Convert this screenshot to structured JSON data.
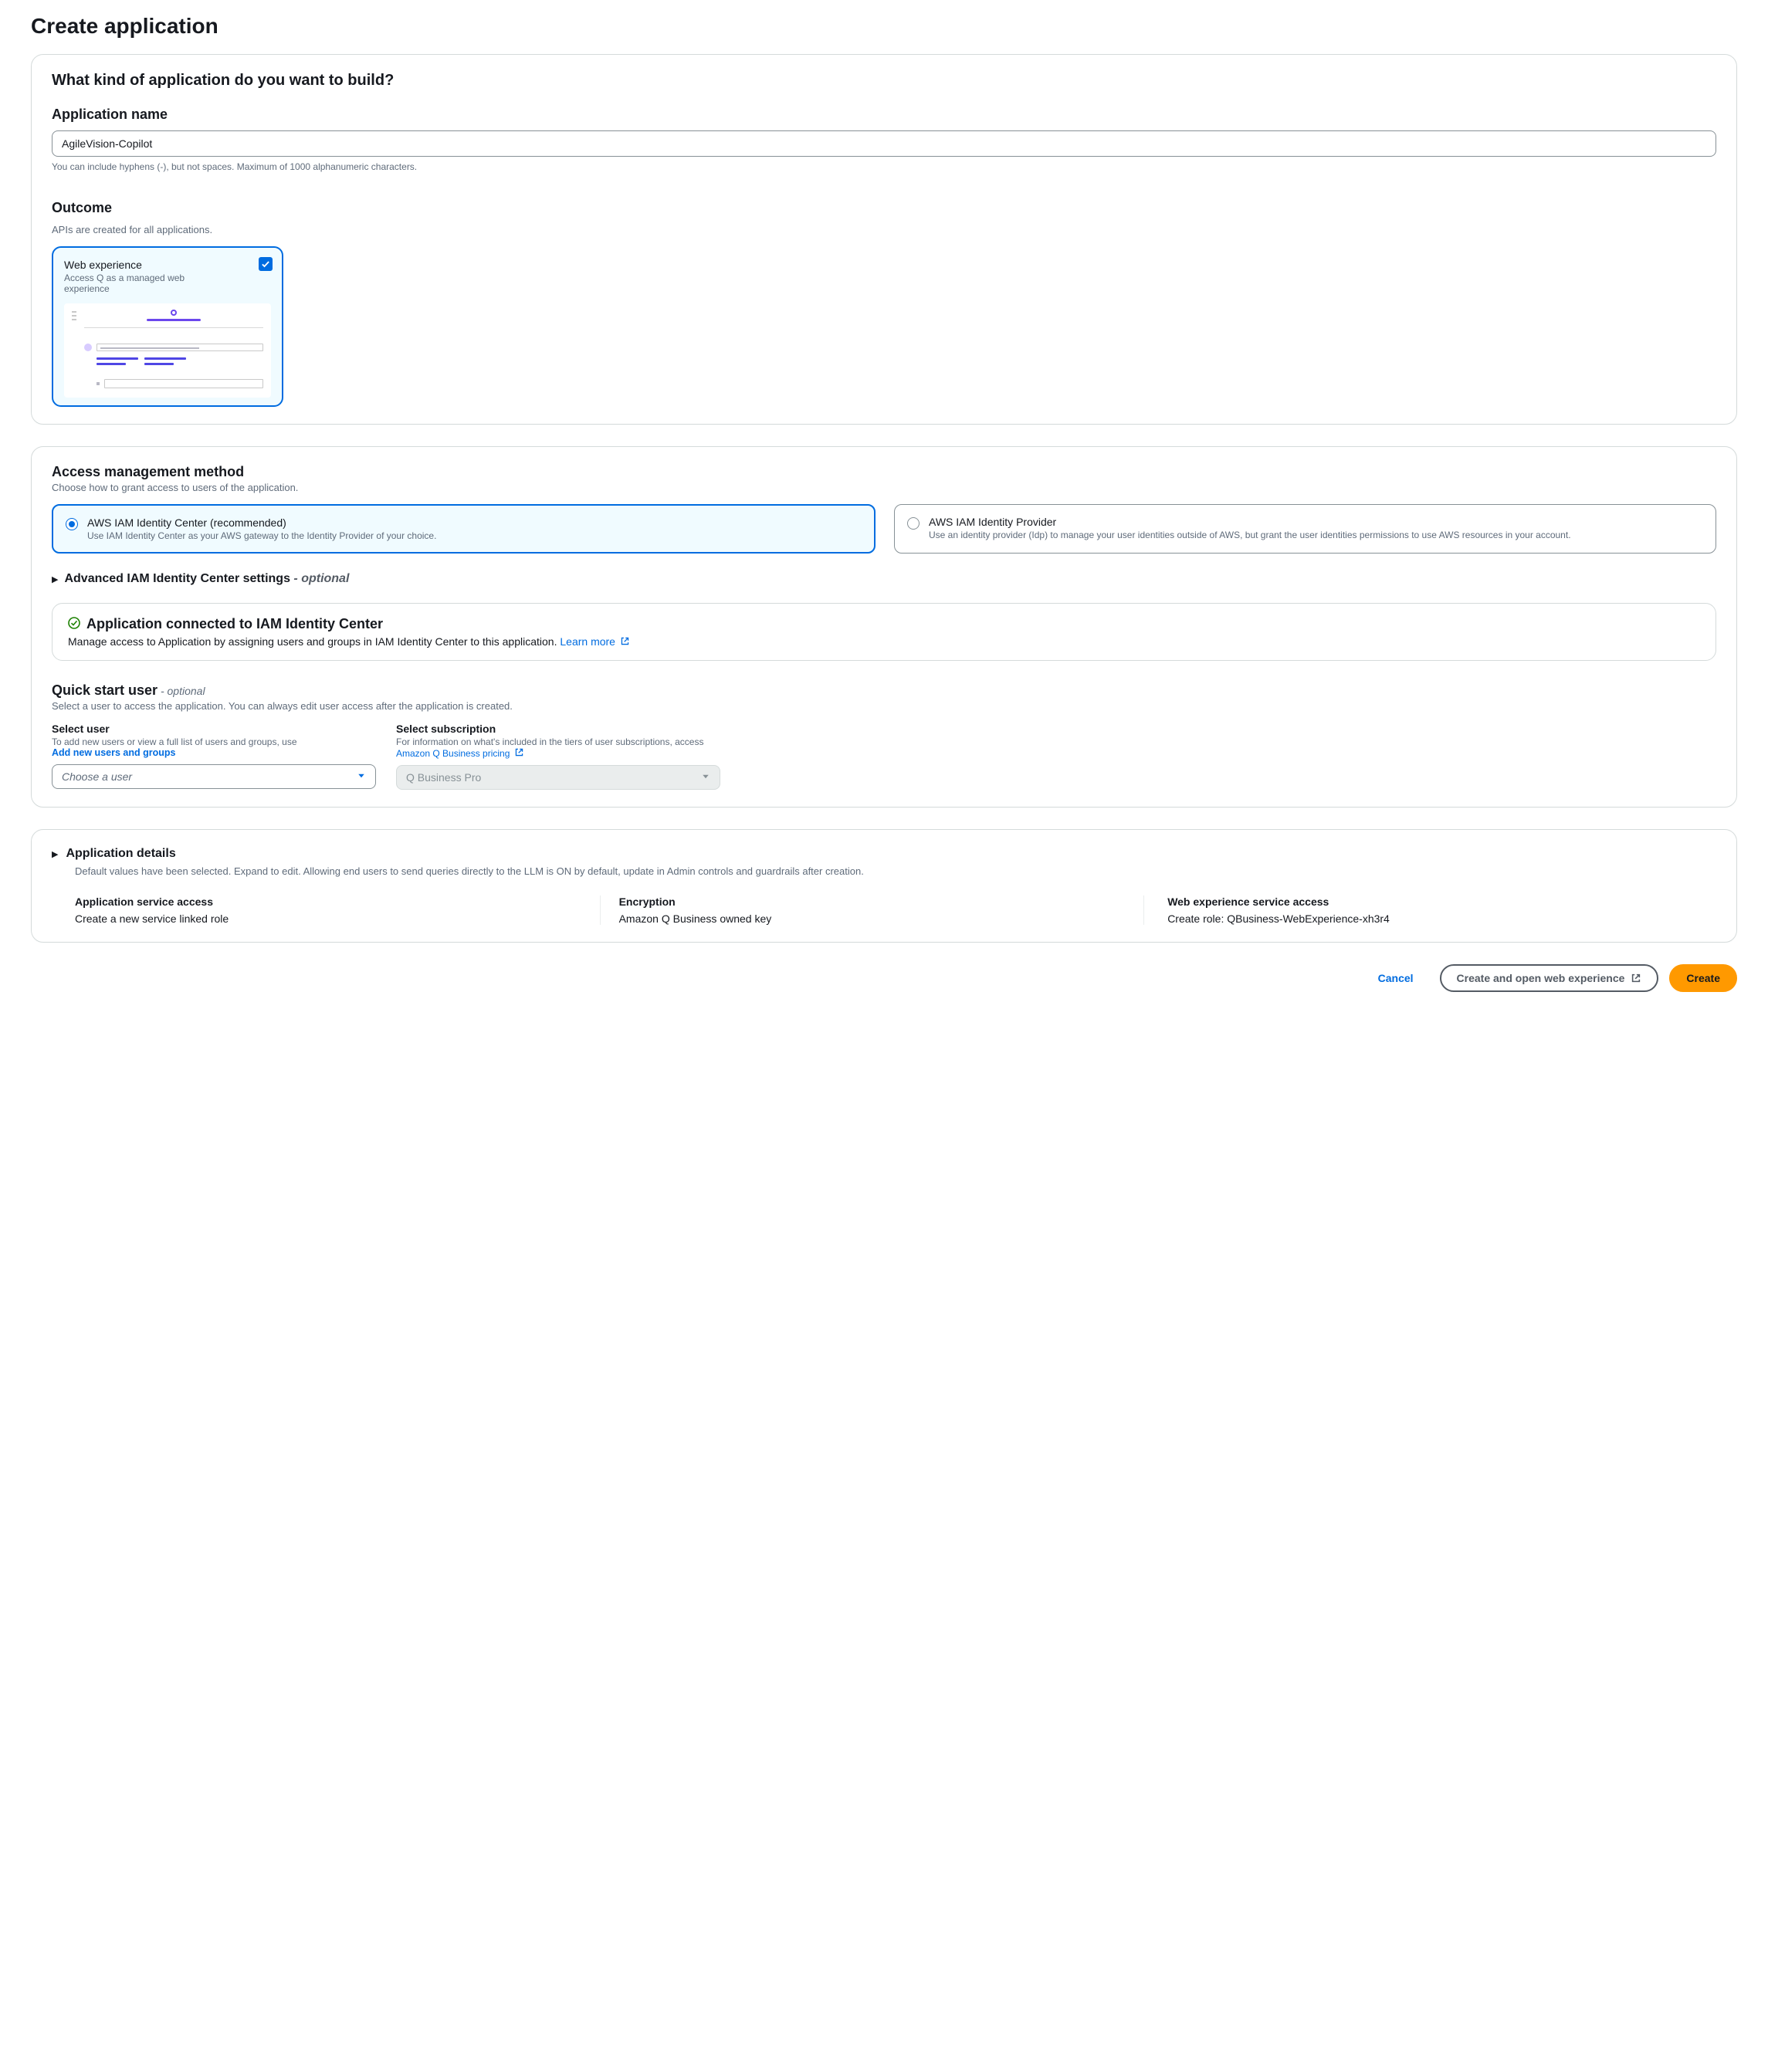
{
  "page": {
    "title": "Create application"
  },
  "kind": {
    "heading": "What kind of application do you want to build?",
    "name_label": "Application name",
    "name_value": "AgileVision-Copilot",
    "name_hint": "You can include hyphens (-), but not spaces. Maximum of 1000 alphanumeric characters.",
    "outcome_label": "Outcome",
    "outcome_hint": "APIs are created for all applications.",
    "card": {
      "title": "Web experience",
      "desc": "Access Q as a managed web experience"
    }
  },
  "access": {
    "heading": "Access management method",
    "sub": "Choose how to grant access to users of the application.",
    "opt1": {
      "title": "AWS IAM Identity Center (recommended)",
      "desc": "Use IAM Identity Center as your AWS gateway to the Identity Provider of your choice."
    },
    "opt2": {
      "title": "AWS IAM Identity Provider",
      "desc": "Use an identity provider (Idp) to manage your user identities outside of AWS, but grant the user identities permissions to use AWS resources in your account."
    },
    "adv_label": "Advanced IAM Identity Center settings",
    "adv_dash": " - ",
    "adv_optional": "optional",
    "status_title": "Application connected to IAM Identity Center",
    "status_desc": "Manage access to Application by assigning users and groups in IAM Identity Center to this application.  ",
    "learn_more": "Learn more",
    "quick_heading": "Quick start user",
    "quick_dash": " - ",
    "quick_optional": "optional",
    "quick_sub": "Select a user to access the application. You can always edit user access after the application is created.",
    "select_user": {
      "label": "Select user",
      "hint": "To add new users or view a full list of users and groups, use",
      "link": "Add new users and groups",
      "placeholder": "Choose a user"
    },
    "select_sub": {
      "label": "Select subscription",
      "hint": "For information on what's included in the tiers of user subscriptions, access ",
      "link": "Amazon Q Business pricing",
      "placeholder": "Q Business Pro"
    }
  },
  "details": {
    "heading": "Application details",
    "sub": "Default values have been selected. Expand to edit. Allowing end users to send queries directly to the LLM is ON by default, update in Admin controls and guardrails after creation.",
    "c1_key": "Application service access",
    "c1_val": "Create a new service linked role",
    "c2_key": "Encryption",
    "c2_val": "Amazon Q Business owned key",
    "c3_key": "Web experience service access",
    "c3_val": "Create role: QBusiness-WebExperience-xh3r4"
  },
  "footer": {
    "cancel": "Cancel",
    "open": "Create and open web experience",
    "create": "Create"
  }
}
